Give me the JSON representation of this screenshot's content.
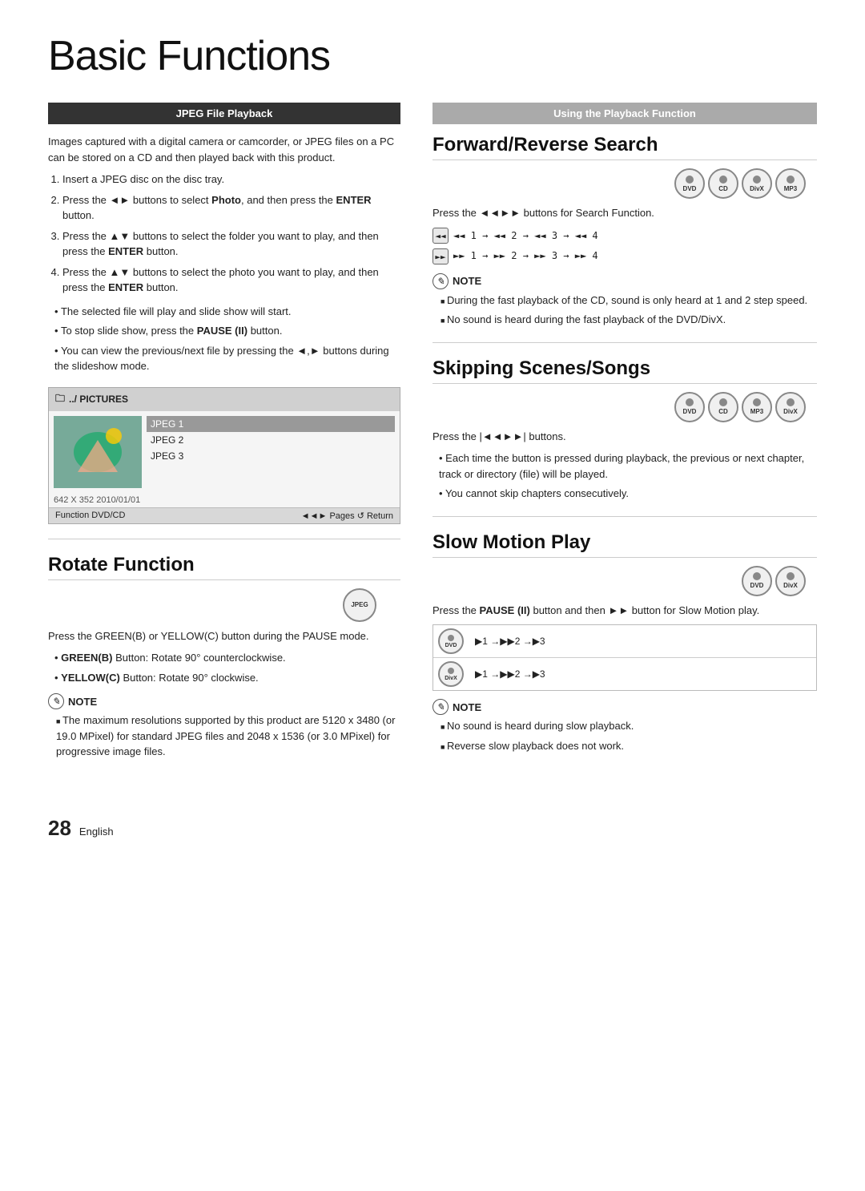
{
  "title": "Basic Functions",
  "page_number": "28",
  "page_language": "English",
  "left": {
    "jpeg_section": {
      "header": "JPEG File Playback",
      "intro": "Images captured with a digital camera or camcorder, or JPEG files on a PC can be stored on a CD and then played back with this product.",
      "steps": [
        "Insert a JPEG disc on the disc tray.",
        "Press the ◄► buttons to select Photo, and then press the ENTER button.",
        "Press the ▲▼ buttons to select the folder you want to play, and then press the ENTER button.",
        "Press the ▲▼ buttons to select the photo you want to play, and then press the ENTER button."
      ],
      "step2_bold": "Photo",
      "step2_bold2": "ENTER",
      "step3_bold": "ENTER",
      "step4_bold": "ENTER",
      "bullets": [
        "The selected file will play and slide show will start.",
        "To stop slide show, press the PAUSE (II) button.",
        "You can view the previous/next file by pressing the ◄,► buttons during the slideshow mode."
      ],
      "screen": {
        "folder": "../ PICTURES",
        "items": [
          "JPEG 1",
          "JPEG 2",
          "JPEG 3"
        ],
        "selected": 0,
        "info": "642 X 352   2010/01/01",
        "footer_left": "Function  DVD/CD",
        "footer_right": "◄◄► Pages  ↺ Return"
      }
    },
    "rotate_section": {
      "header": "Rotate Function",
      "disc_label": "JPEG",
      "intro": "Press the GREEN(B) or YELLOW(C) button during the PAUSE mode.",
      "bullets": [
        "GREEN(B) Button: Rotate 90° counterclockwise.",
        "YELLOW(C) Button: Rotate 90° clockwise."
      ],
      "note_label": "NOTE",
      "notes": [
        "The maximum resolutions supported by this product are 5120 x 3480 (or 19.0 MPixel) for standard JPEG files and 2048 x 1536 (or 3.0 MPixel) for progressive image files."
      ]
    }
  },
  "right": {
    "playback_section_header": "Using the Playback Function",
    "forward_reverse": {
      "title": "Forward/Reverse Search",
      "discs": [
        "DVD",
        "CD",
        "DivX",
        "MP3"
      ],
      "intro": "Press the ◄◄►► buttons for Search Function.",
      "rewind_steps": "◄◄ 1 → ◄◄ 2 → ◄◄ 3 → ◄◄ 4",
      "forward_steps": "►► 1 → ►► 2 → ►► 3 → ►► 4",
      "note_label": "NOTE",
      "notes": [
        "During the fast playback of the CD, sound is only heard at 1 and 2 step speed.",
        "No sound is heard during the fast playback of the DVD/DivX."
      ]
    },
    "skipping": {
      "title": "Skipping Scenes/Songs",
      "discs": [
        "DVD",
        "CD",
        "MP3",
        "DivX"
      ],
      "intro": "Press the |◄◄►►| buttons.",
      "bullets": [
        "Each time the button is pressed during playback, the previous or next chapter, track or directory (file) will be played.",
        "You cannot skip chapters consecutively."
      ]
    },
    "slow_motion": {
      "title": "Slow Motion Play",
      "discs": [
        "DVD",
        "DivX"
      ],
      "intro": "Press the PAUSE (II) button and then ►► button for Slow Motion play.",
      "rows": [
        {
          "disc": "DVD",
          "steps": "▶1 →▶▶2 →▶3"
        },
        {
          "disc": "DivX",
          "steps": "▶1 →▶▶2 →▶3"
        }
      ],
      "note_label": "NOTE",
      "notes": [
        "No sound is heard during slow playback.",
        "Reverse slow playback does not work."
      ]
    }
  }
}
